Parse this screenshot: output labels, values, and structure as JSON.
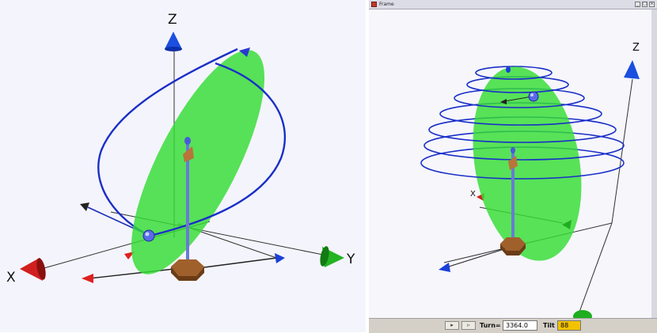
{
  "left_view": {
    "axis_labels": {
      "x": "X",
      "y": "Y",
      "z": "Z"
    }
  },
  "right_window": {
    "title": "Frame",
    "window_controls": [
      "_",
      "□",
      "×"
    ],
    "view": {
      "axis_label_z": "Z",
      "axis_label_x": "X"
    },
    "status_bar": {
      "play_button": "▸",
      "step_button": "▹",
      "turn_label": "Turn=",
      "turn_value": "3364.0",
      "tilt_label": "Tilt :",
      "tilt_value": "88"
    }
  },
  "colors": {
    "disc": "#33dd33",
    "spiral": "#1a2fc8",
    "z_cone": "#1a4fe0",
    "x_cone": "#cc1a1a",
    "y_cone": "#1fae1f",
    "rod": "#6a7ad6",
    "base": "#a0602c"
  },
  "icons": {
    "play": "play-icon",
    "step": "step-icon"
  }
}
